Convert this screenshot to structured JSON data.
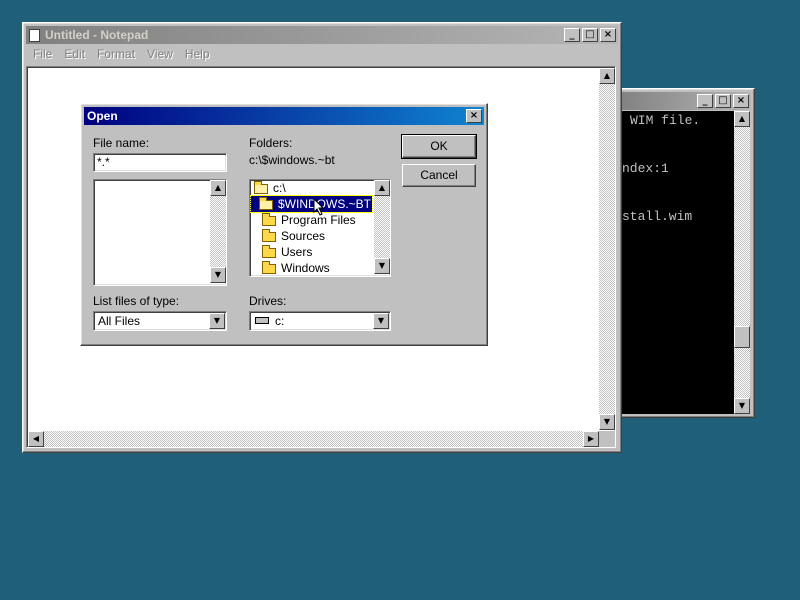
{
  "console_window": {
    "lines": [
      "WIM file.",
      "ndex:1",
      "stall.wim"
    ],
    "buttons": {
      "min": "_",
      "max": "□",
      "close": "×"
    }
  },
  "notepad": {
    "title": "Untitled - Notepad",
    "menu": [
      "File",
      "Edit",
      "Format",
      "View",
      "Help"
    ],
    "buttons": {
      "min": "_",
      "max": "□",
      "close": "×"
    }
  },
  "open_dialog": {
    "title": "Open",
    "close": "×",
    "file_name_label": "File name:",
    "file_name_value": "*.*",
    "folders_label": "Folders:",
    "current_path": "c:\\$windows.~bt",
    "folder_tree": [
      {
        "label": "c:\\",
        "state": "open"
      },
      {
        "label": "$WINDOWS.~BT",
        "state": "open-selected"
      },
      {
        "label": "Program Files",
        "state": "closed"
      },
      {
        "label": "Sources",
        "state": "closed"
      },
      {
        "label": "Users",
        "state": "closed"
      },
      {
        "label": "Windows",
        "state": "closed"
      }
    ],
    "ok_label": "OK",
    "cancel_label": "Cancel",
    "list_type_label": "List files of type:",
    "list_type_value": "All Files",
    "drives_label": "Drives:",
    "drives_value": "c:"
  },
  "arrows": {
    "up": "▲",
    "down": "▼",
    "left": "◀",
    "right": "▶"
  },
  "colors": {
    "desktop": "#1f5f7a",
    "selection": "#000080",
    "title_active": "#000080"
  }
}
